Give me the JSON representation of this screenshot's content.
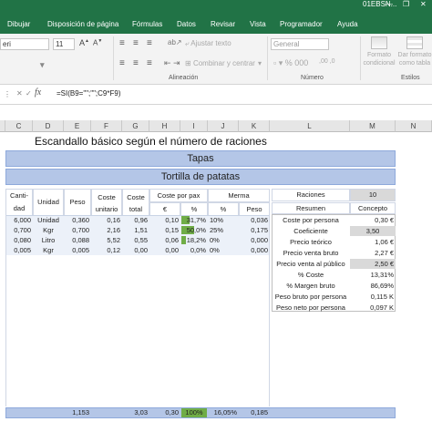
{
  "titlebar": {
    "doc": "01EBSN...",
    "minimize": "—",
    "restore": "❐",
    "close": "✕"
  },
  "menu": [
    "Dibujar",
    "Disposición de página",
    "Fórmulas",
    "Datos",
    "Revisar",
    "Vista",
    "Programador",
    "Ayuda"
  ],
  "ribbon": {
    "font_name": "eri",
    "font_size": "11",
    "wrap_text": "Ajustar texto",
    "merge_center": "Combinar y centrar",
    "number_format": "General",
    "cond_format": "Formato condicional",
    "format_table": "Dar formato como tabla",
    "alignment_group": "Alineación",
    "number_group": "Número",
    "styles_group": "Estilos"
  },
  "formula_bar": {
    "fx": "fx",
    "formula": "=SI(B9=\"\";\"\";C9*F9)"
  },
  "columns": [
    "C",
    "D",
    "E",
    "F",
    "G",
    "H",
    "I",
    "J",
    "K",
    "L",
    "M",
    "N"
  ],
  "sheet": {
    "title": "Escandallo básico según el número de raciones",
    "banner1": "Tapas",
    "banner2": "Tortilla de patatas",
    "headers": {
      "cantidad": "Canti-dad",
      "unidad": "Unidad",
      "peso": "Peso",
      "coste_unitario": "Coste unitario",
      "coste_total": "Coste total",
      "coste_por_pax": "Coste por pax",
      "euro": "€",
      "pct": "%",
      "merma": "Merma",
      "merma_pct": "%",
      "merma_peso": "Peso"
    },
    "rows": [
      {
        "cant": "6,000",
        "unid": "Unidad",
        "peso": "0,360",
        "cu": "0,16",
        "ct": "0,96",
        "eur": "0,10",
        "pct": "31,7%",
        "mpct": "10%",
        "mpeso": "0,036"
      },
      {
        "cant": "0,700",
        "unid": "Kgr",
        "peso": "0,700",
        "cu": "2,16",
        "ct": "1,51",
        "eur": "0,15",
        "pct": "50,0%",
        "mpct": "25%",
        "mpeso": "0,175"
      },
      {
        "cant": "0,080",
        "unid": "Litro",
        "peso": "0,088",
        "cu": "5,52",
        "ct": "0,55",
        "eur": "0,06",
        "pct": "18,2%",
        "mpct": "0%",
        "mpeso": "0,000"
      },
      {
        "cant": "0,005",
        "unid": "Kgr",
        "peso": "0,005",
        "cu": "0,12",
        "ct": "0,00",
        "eur": "0,00",
        "pct": "0,0%",
        "mpct": "0%",
        "mpeso": "0,000"
      }
    ],
    "bars": [
      0.317,
      0.5,
      0.182,
      0.0
    ],
    "totals": {
      "peso": "1,153",
      "ct": "3,03",
      "eur": "0,30",
      "pct": "100%",
      "mpct": "16,05%",
      "mpeso": "0,185"
    },
    "raciones_label": "Raciones",
    "raciones_value": "10",
    "summary_header": {
      "resumen": "Resumen",
      "concepto": "Concepto"
    },
    "summary": [
      {
        "label": "Coste por persona",
        "value": "0,30 €"
      },
      {
        "label": "Coeficiente",
        "value": "3,50"
      },
      {
        "label": "Precio teórico",
        "value": "1,06 €"
      },
      {
        "label": "Precio venta bruto",
        "value": "2,27 €"
      },
      {
        "label": "Precio venta al público",
        "value": "2,50 €"
      },
      {
        "label": "% Coste",
        "value": "13,31%"
      },
      {
        "label": "% Margen bruto",
        "value": "86,69%"
      },
      {
        "label": "Peso bruto por persona",
        "value": "0,115 K"
      },
      {
        "label": "Peso neto por persona",
        "value": "0,097 K"
      }
    ]
  },
  "colors": {
    "excel_green": "#217346",
    "header_blue": "#b4c6e7",
    "bar_green": "#70ad47"
  }
}
